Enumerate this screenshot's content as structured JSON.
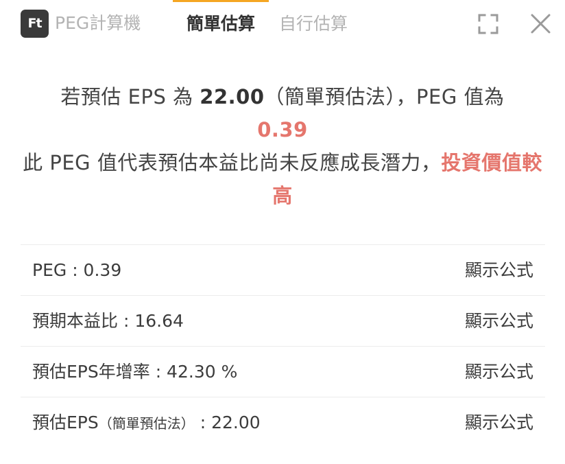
{
  "header": {
    "logo_text": "Ft",
    "app_title": "PEG計算機",
    "tabs": [
      {
        "label": "簡單估算",
        "active": true
      },
      {
        "label": "自行估算",
        "active": false
      }
    ],
    "accent_color": "#f5a623",
    "icons": [
      "expand-icon",
      "close-icon"
    ]
  },
  "message": {
    "prefix": "若預估 EPS 為 ",
    "eps": "22.00",
    "method": "（簡單預估法）",
    "peg_label": "，PEG 值為",
    "peg_value": "0.39",
    "line3": "此 PEG 值代表預估本益比尚未反應成長潛力，",
    "conclusion": "投資價值較高",
    "highlight_color": "#e5766d"
  },
  "rows": [
    {
      "label": "PEG : 0.39",
      "action": "顯示公式"
    },
    {
      "label": "預期本益比 : 16.64",
      "action": "顯示公式"
    },
    {
      "label": "預估EPS年增率 : 42.30 %",
      "action": "顯示公式"
    },
    {
      "label_main": "預估EPS",
      "label_note": "（簡單預估法）",
      "label_value": " : 22.00",
      "action": "顯示公式"
    }
  ]
}
